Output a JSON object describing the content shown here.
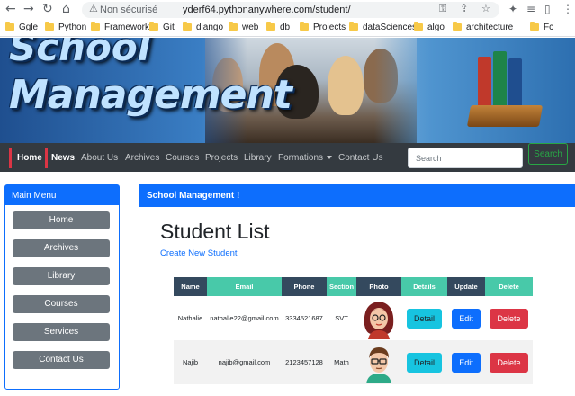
{
  "browser": {
    "security_label": "Non sécurisé",
    "url": "yderf64.pythonanywhere.com/student/",
    "bookmarks": [
      "Ggle",
      "Python",
      "Framework",
      "Git",
      "django",
      "web",
      "db",
      "Projects",
      "dataSciences",
      "algo",
      "architecture",
      "Fc"
    ]
  },
  "banner": {
    "title_line1": "School",
    "title_line2": "Management"
  },
  "navbar": {
    "links": [
      "Home",
      "News",
      "About Us",
      "Archives",
      "Courses",
      "Projects",
      "Library",
      "Formations",
      "Contact Us"
    ],
    "search_placeholder": "Search",
    "search_button": "Search"
  },
  "sidebar": {
    "title": "Main Menu",
    "items": [
      "Home",
      "Archives",
      "Library",
      "Courses",
      "Services",
      "Contact Us"
    ]
  },
  "main": {
    "header": "School Management !",
    "page_title": "Student List",
    "create_link": "Create New Student"
  },
  "table": {
    "headers": [
      "Name",
      "Email",
      "Phone",
      "Section",
      "Photo",
      "Details",
      "Update",
      "Delete"
    ],
    "header_colors": [
      "#34495e",
      "#48c9a9",
      "#34495e",
      "#48c9a9",
      "#34495e",
      "#48c9a9",
      "#34495e",
      "#48c9a9"
    ],
    "rows": [
      {
        "name": "Nathalie",
        "email": "nathalie22@gmail.com",
        "phone": "3334521687",
        "section": "SVT",
        "photo": "female-avatar-icon",
        "detail": "Detail",
        "edit": "Edit",
        "delete": "Delete"
      },
      {
        "name": "Najib",
        "email": "najib@gmail.com",
        "phone": "2123457128",
        "section": "Math",
        "photo": "male-avatar-icon",
        "detail": "Detail",
        "edit": "Edit",
        "delete": "Delete"
      }
    ]
  },
  "colors": {
    "primary": "#0d6efd",
    "navbar": "#343a40",
    "sidebar_button": "#6c757d",
    "detail": "#17c4e0",
    "delete": "#dc3545",
    "search_outline": "#28a745"
  }
}
